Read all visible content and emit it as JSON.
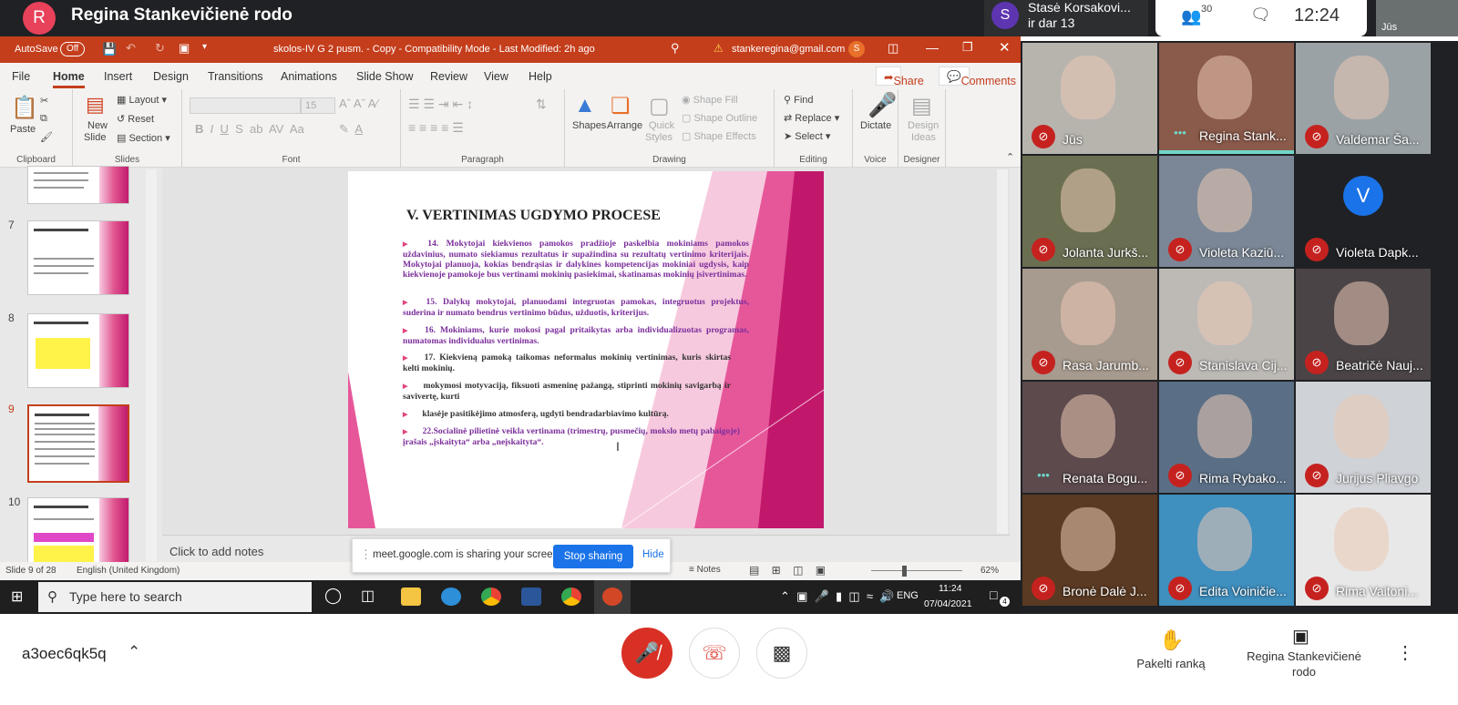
{
  "meet": {
    "presenter_initial": "R",
    "presenter_title": "Regina Stankevičienė rodo",
    "top_person": {
      "initial": "S",
      "name": "Stasė Korsakovi...",
      "sub": "ir dar 13"
    },
    "people_count": "30",
    "clock": "12:24",
    "self_label": "Jūs"
  },
  "ppt": {
    "autosave": "AutoSave",
    "autosave_state": "Off",
    "doc_title": "skolos-IV G 2 pusm. - Copy  -  Compatibility Mode  -  Last Modified: 2h ago",
    "account": "stankeregina@gmail.com",
    "account_initial": "S",
    "tabs": [
      "File",
      "Home",
      "Insert",
      "Design",
      "Transitions",
      "Animations",
      "Slide Show",
      "Review",
      "View",
      "Help"
    ],
    "share": "Share",
    "comments": "Comments",
    "ribbon": {
      "paste": "Paste",
      "clipboard": "Clipboard",
      "new_slide": "New",
      "new_slide2": "Slide",
      "layout": "Layout",
      "reset": "Reset",
      "section": "Section",
      "slides": "Slides",
      "font_size": "15",
      "font": "Font",
      "paragraph": "Paragraph",
      "shapes": "Shapes",
      "arrange": "Arrange",
      "quick_styles": "Quick",
      "quick_styles2": "Styles",
      "shape_fill": "Shape Fill",
      "shape_outline": "Shape Outline",
      "shape_effects": "Shape Effects",
      "drawing": "Drawing",
      "find": "Find",
      "replace": "Replace",
      "select": "Select",
      "editing": "Editing",
      "dictate": "Dictate",
      "voice": "Voice",
      "design_ideas": "Design",
      "design_ideas2": "Ideas",
      "designer": "Designer"
    },
    "thumb_numbers": [
      "7",
      "8",
      "9",
      "10"
    ],
    "slide": {
      "title": "V. VERTINIMAS UGDYMO PROCESE",
      "p1": "14. Mokytojai kiekvienos pamokos pradžioje paskelbia mokiniams pamokos uždavinius, numato siekiamus rezultatus ir supažindina su rezultatų vertinimo kriterijais. Mokytojai planuoja, kokias bendrąsias ir dalykines kompetencijas mokiniai ugdysis, kaip kiekvienoje pamokoje bus vertinami mokinių pasiekimai, skatinamas mokinių įsivertinimas.",
      "p2": "15. Dalykų mokytojai, planuodami integruotas pamokas, integruotus projektus, suderina ir numato bendrus vertinimo būdus, užduotis, kriterijus.",
      "p3": "16. Mokiniams, kurie mokosi pagal pritaikytas arba individualizuotas programas, numatomas individualus vertinimas.",
      "p4": "17. Kiekvieną pamoką taikomas neformalus mokinių vertinimas, kuris skirtas kelti mokinių.",
      "p5": "mokymosi motyvaciją, fiksuoti asmeninę pažangą, stiprinti mokinių savigarbą ir savivertę, kurti",
      "p6": "klasėje pasitikėjimo atmosferą, ugdyti bendradarbiavimo kultūrą.",
      "p7": "22.Socialinė pilietinė veikla vertinama (trimestrų, pusmečių, mokslo metų pabaigoje) įrašais „įskaityta“ arba „neįskaityta“."
    },
    "notes_placeholder": "Click to add notes",
    "share_text": "meet.google.com is sharing your screen.",
    "stop_sharing": "Stop sharing",
    "hide": "Hide",
    "status_slide": "Slide 9 of 28",
    "status_lang": "English (United Kingdom)",
    "status_notes": "Notes",
    "zoom": "62%",
    "taskbar_search": "Type here to search",
    "tray_lang": "ENG",
    "tray_time": "11:24",
    "tray_date": "07/04/2021",
    "tray_badge": "4"
  },
  "participants": [
    {
      "name": "Jūs",
      "bg": "#b7b4ae"
    },
    {
      "name": "Regina Stank...",
      "bg": "#8a5a4a"
    },
    {
      "name": "Valdemar Ša...",
      "bg": "#9aa2a6"
    },
    {
      "name": "Jolanta Jurkš...",
      "bg": "#6b6f52"
    },
    {
      "name": "Violeta Kaziū...",
      "bg": "#7b8796"
    },
    {
      "name": "Violeta Dapk...",
      "bg": "#202124",
      "initial": "V"
    },
    {
      "name": "Rasa Jarumb...",
      "bg": "#a79a8e"
    },
    {
      "name": "Stanislava Cij...",
      "bg": "#bdbab6"
    },
    {
      "name": "Beatričė Nauj...",
      "bg": "#4a4447"
    },
    {
      "name": "Renata Bogu...",
      "bg": "#5c4a4d"
    },
    {
      "name": "Rima Rybako...",
      "bg": "#5a6f86"
    },
    {
      "name": "Jurijus Pliavgo",
      "bg": "#cfd2d6"
    },
    {
      "name": "Bronė Dalė J...",
      "bg": "#5a3a22"
    },
    {
      "name": "Edita Voiničie...",
      "bg": "#3f8fbf"
    },
    {
      "name": "Rima Vaitoni...",
      "bg": "#e8e8e8"
    }
  ],
  "bottom": {
    "meeting_code": "a3oec6qk5q",
    "raise_hand": "Pakelti ranką",
    "presenting": "Regina Stankevičienė rodo"
  }
}
